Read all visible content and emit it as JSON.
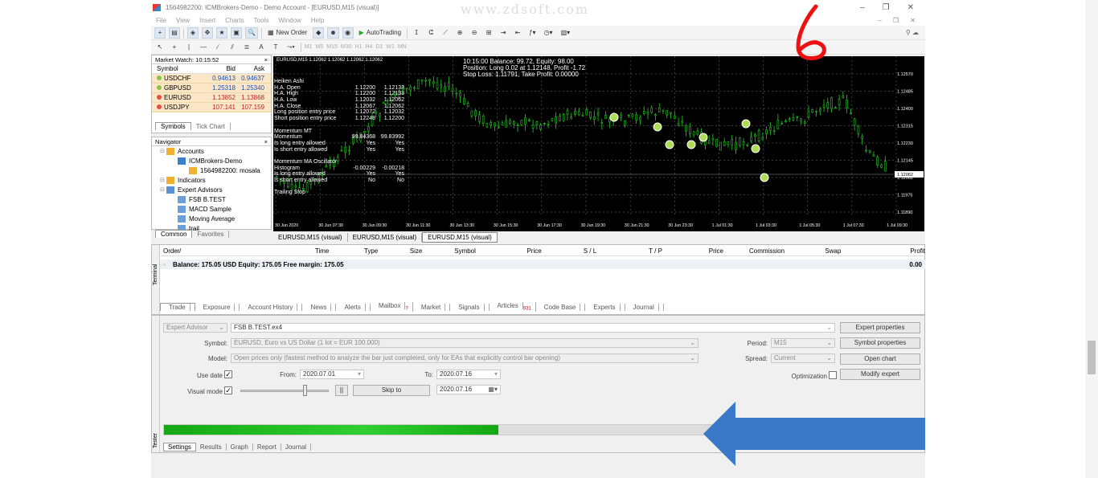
{
  "window": {
    "title": "1564982200: ICMBrokers-Demo - Demo Account - [EURUSD,M15 (visual)]",
    "watermark": "www.zdsoft.com",
    "minimize": "–",
    "restore": "❐",
    "close": "✕"
  },
  "menu": {
    "items": [
      "File",
      "View",
      "Insert",
      "Charts",
      "Tools",
      "Window",
      "Help"
    ],
    "mdi_controls": "– ❐ ✕"
  },
  "toolbar": {
    "new_order": "New Order",
    "auto_trading": "AutoTrading",
    "timeframes": [
      "M1",
      "M5",
      "M15",
      "M30",
      "H1",
      "H4",
      "D1",
      "W1",
      "MN"
    ]
  },
  "market_watch": {
    "title": "Market Watch: 10:15:52",
    "close": "×",
    "columns": [
      "Symbol",
      "Bid",
      "Ask"
    ],
    "rows": [
      {
        "symbol": "USDCHF",
        "bid": "0.94613",
        "ask": "0.94637",
        "dir": "up"
      },
      {
        "symbol": "GBPUSD",
        "bid": "1.25318",
        "ask": "1.25340",
        "dir": "up"
      },
      {
        "symbol": "EURUSD",
        "bid": "1.13852",
        "ask": "1.13868",
        "dir": "down"
      },
      {
        "symbol": "USDJPY",
        "bid": "107.141",
        "ask": "107.159",
        "dir": "down"
      }
    ],
    "tabs": [
      "Symbols",
      "Tick Chart"
    ]
  },
  "navigator": {
    "title": "Navigator",
    "close": "×",
    "items": [
      {
        "label": "Accounts",
        "indent": 0
      },
      {
        "label": "ICMBrokers-Demo",
        "indent": 1
      },
      {
        "label": "1564982200: mosala",
        "indent": 2
      },
      {
        "label": "Indicators",
        "indent": 0
      },
      {
        "label": "Expert Advisors",
        "indent": 0
      },
      {
        "label": "FSB B.TEST",
        "indent": 1
      },
      {
        "label": "MACD Sample",
        "indent": 1
      },
      {
        "label": "Moving Average",
        "indent": 1
      },
      {
        "label": "trail",
        "indent": 1
      }
    ],
    "tabs": [
      "Common",
      "Favorites"
    ]
  },
  "chart": {
    "header": "EURUSD,M15  1.12062 1.12062 1.12062 1.12062",
    "info_lines": [
      "10:15:00 Balance: 99.72, Equity: 98.00",
      "Position: Long 0.02 at 1.12148, Profit -1.72",
      "Stop Loss: 1.11791, Take Profit: 0.00000"
    ],
    "indicator_lines": [
      {
        "label": "Heiken Ashi",
        "v1": "",
        "v2": ""
      },
      {
        "label": "H.A. Open",
        "v1": "1.12200",
        "v2": "1.12133"
      },
      {
        "label": "H.A. High",
        "v1": "1.12200",
        "v2": "1.12133"
      },
      {
        "label": "H.A. Low",
        "v1": "1.12032",
        "v2": "1.12062"
      },
      {
        "label": "H.A. Close",
        "v1": "1.12067",
        "v2": "1.12062"
      },
      {
        "label": "Long position entry price",
        "v1": "1.12072",
        "v2": "1.12032"
      },
      {
        "label": "Short position entry price",
        "v1": "1.12248",
        "v2": "1.12200"
      },
      {
        "label": "",
        "v1": "",
        "v2": ""
      },
      {
        "label": "Momentum MT",
        "v1": "",
        "v2": ""
      },
      {
        "label": "Momentum",
        "v1": "99.84368",
        "v2": "99.83992"
      },
      {
        "label": "Is long entry allowed",
        "v1": "Yes",
        "v2": "Yes"
      },
      {
        "label": "Is short entry allowed",
        "v1": "Yes",
        "v2": "Yes"
      },
      {
        "label": "",
        "v1": "",
        "v2": ""
      },
      {
        "label": "Momentum MA Oscillator",
        "v1": "",
        "v2": ""
      },
      {
        "label": "Histogram",
        "v1": "-0.00229",
        "v2": "-0.00218"
      },
      {
        "label": "Is long entry allowed",
        "v1": "Yes",
        "v2": "Yes"
      },
      {
        "label": "Is short entry allowed",
        "v1": "No",
        "v2": "No"
      },
      {
        "label": "",
        "v1": "",
        "v2": ""
      },
      {
        "label": "Trailing Stop",
        "v1": "",
        "v2": ""
      }
    ],
    "price_labels": [
      "1.12570",
      "1.12485",
      "1.12400",
      "1.12315",
      "1.12230",
      "1.12145",
      "1.12062",
      "1.11975",
      "1.11890"
    ],
    "current_price": "1.12062",
    "time_labels": [
      "30 Jun 2020",
      "30 Jun 07:30",
      "30 Jun 09:30",
      "30 Jun 11:30",
      "30 Jun 13:30",
      "30 Jun 15:30",
      "30 Jun 17:30",
      "30 Jun 19:30",
      "30 Jun 21:30",
      "30 Jun 23:30",
      "1 Jul 01:30",
      "1 Jul 03:30",
      "1 Jul 05:30",
      "1 Jul 07:30",
      "1 Jul 09:30"
    ],
    "bull_color": "#22cc22",
    "grid_color": "#777777"
  },
  "chart_tabs": [
    "EURUSD,M15 (visual)",
    "EURUSD,M15 (visual)",
    "EURUSD,M15 (visual)"
  ],
  "terminal": {
    "side_label": "Terminal",
    "columns": [
      "Order",
      "/",
      "Time",
      "Type",
      "Size",
      "Symbol",
      "Price",
      "S / L",
      "T / P",
      "Price",
      "Commission",
      "Swap",
      "Profit"
    ],
    "balance_text": "Balance: 175.05 USD  Equity: 175.05  Free margin: 175.05",
    "balance_profit": "0.00",
    "tabs": [
      {
        "label": "Trade",
        "badge": ""
      },
      {
        "label": "Exposure",
        "badge": ""
      },
      {
        "label": "Account History",
        "badge": ""
      },
      {
        "label": "News",
        "badge": ""
      },
      {
        "label": "Alerts",
        "badge": ""
      },
      {
        "label": "Mailbox",
        "badge": "7"
      },
      {
        "label": "Market",
        "badge": ""
      },
      {
        "label": "Signals",
        "badge": ""
      },
      {
        "label": "Articles",
        "badge": "931"
      },
      {
        "label": "Code Base",
        "badge": ""
      },
      {
        "label": "Experts",
        "badge": ""
      },
      {
        "label": "Journal",
        "badge": ""
      }
    ]
  },
  "tester": {
    "side_label": "Tester",
    "mode": "Expert Advisor",
    "expert": "FSB B.TEST.ex4",
    "symbol_label": "Symbol:",
    "symbol_value": "EURUSD, Euro vs US Dollar  (1 lot = EUR 100.000)",
    "model_label": "Model:",
    "model_value": "Open prices only (fastest method to analyze the bar just completed, only for EAs that explicitly control bar opening)",
    "period_label": "Period:",
    "period_value": "M15",
    "spread_label": "Spread:",
    "spread_value": "Current",
    "use_date_label": "Use date",
    "from_label": "From:",
    "from_value": "2020.07.01",
    "to_label": "To:",
    "to_value": "2020.07.16",
    "visual_mode_label": "Visual mode",
    "pause_button": "||",
    "skip_to_button": "Skip to",
    "skip_to_value": "2020.07.16",
    "optimization_label": "Optimization",
    "buttons": [
      "Expert properties",
      "Symbol properties",
      "Open chart",
      "Modify expert"
    ],
    "progress": 0.44,
    "tabs": [
      "Settings",
      "Results",
      "Graph",
      "Report",
      "Journal"
    ]
  },
  "annotations": {
    "handwritten": "6",
    "arrow_color": "#3a78c8",
    "pen_color": "#ee1111"
  }
}
